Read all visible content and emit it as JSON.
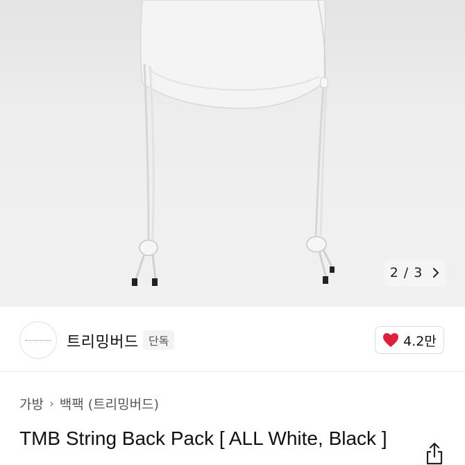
{
  "gallery": {
    "current": "2",
    "separator": "/",
    "total": "3"
  },
  "seller": {
    "name": "트리밍버드",
    "badge": "단독"
  },
  "likes": {
    "count": "4.2만"
  },
  "breadcrumb": {
    "items": [
      "가방",
      "백팩 (트리밍버드)"
    ]
  },
  "product": {
    "title": "TMB String Back Pack [ ALL White, Black ]"
  },
  "colors": {
    "heart": "#e0203a",
    "hero_bg": "#eeeeee"
  },
  "icons": {
    "next": "chevron-right-icon",
    "like": "heart-icon",
    "share": "share-icon"
  }
}
